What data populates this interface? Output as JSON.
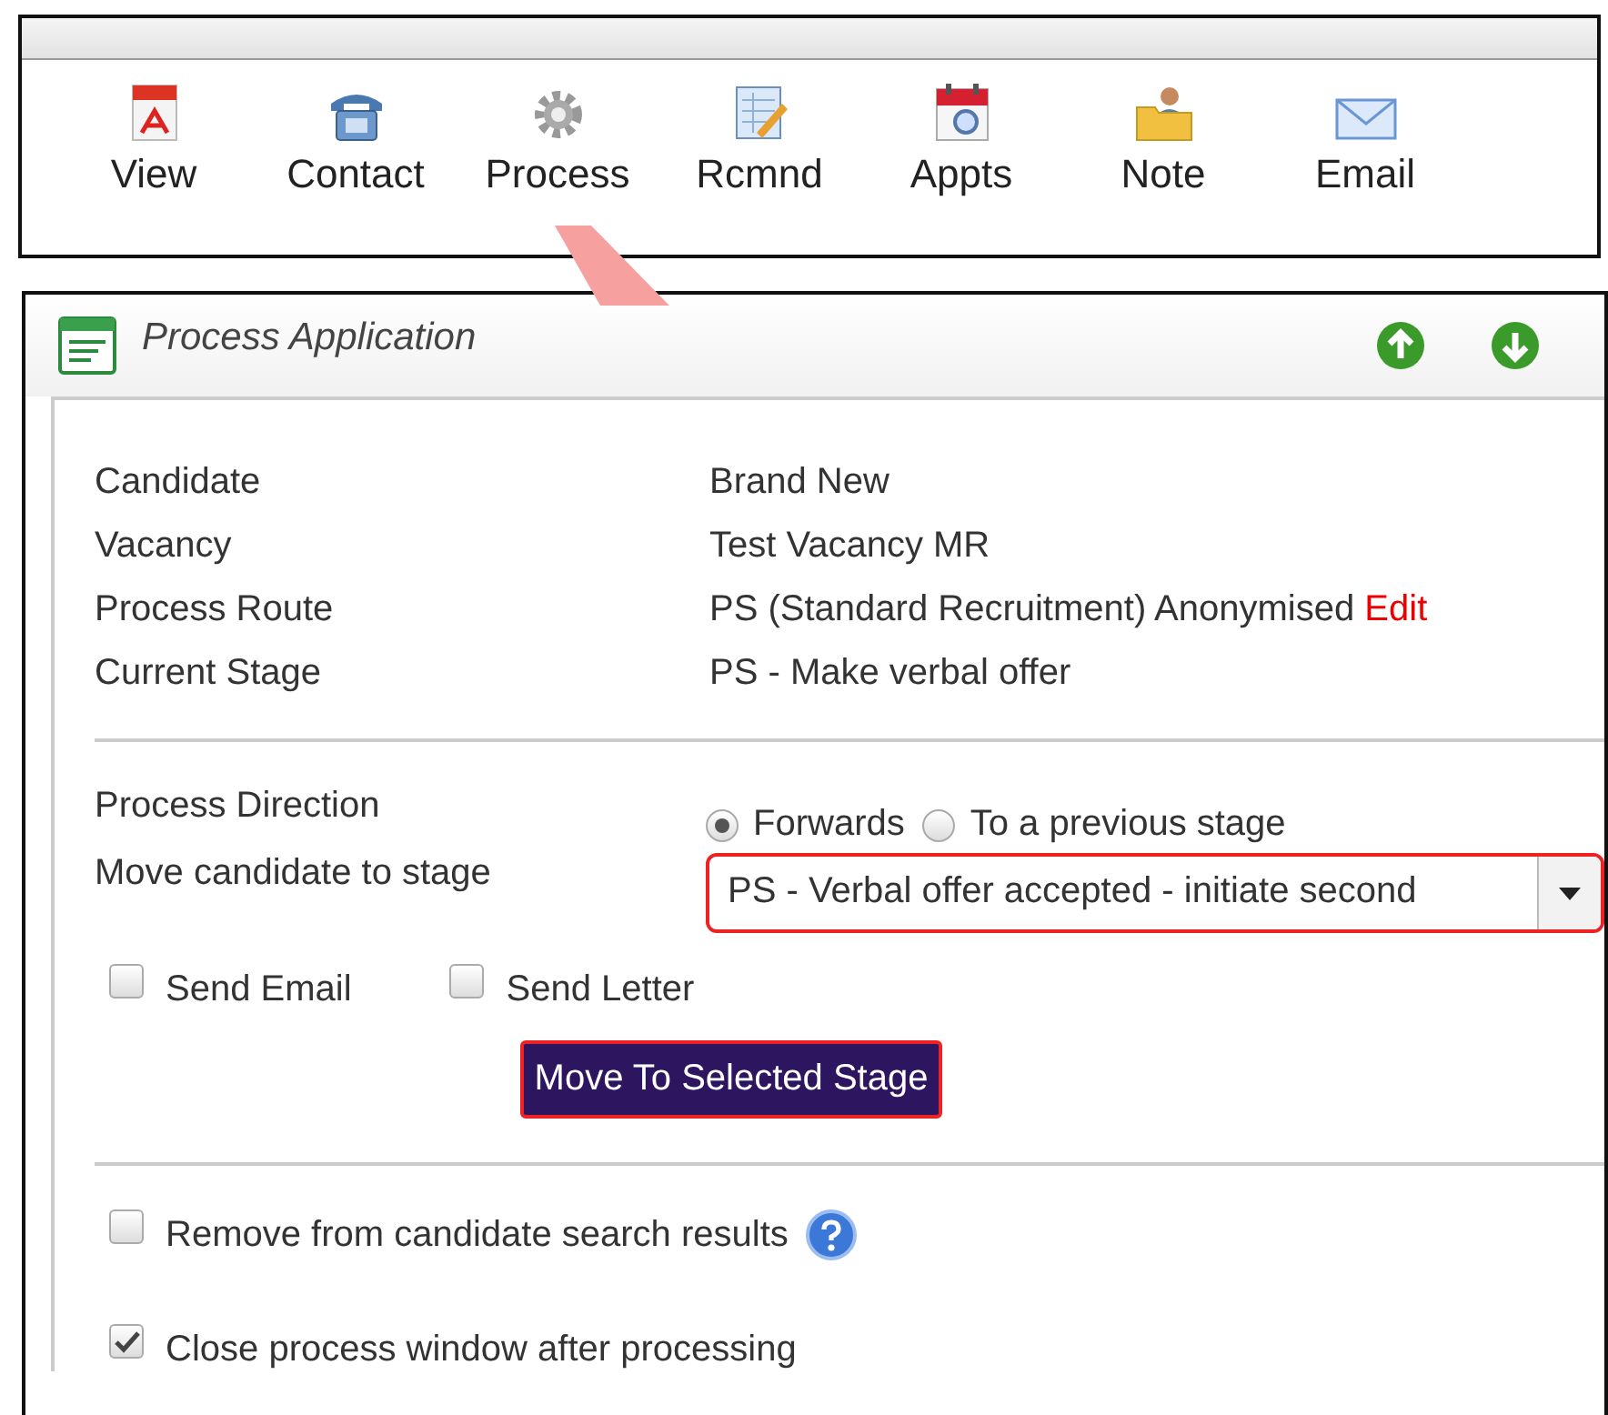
{
  "toolbar": {
    "items": [
      {
        "label": "View",
        "kind": "pdf"
      },
      {
        "label": "Contact",
        "kind": "phone"
      },
      {
        "label": "Process",
        "kind": "gear"
      },
      {
        "label": "Rcmnd",
        "kind": "notepad"
      },
      {
        "label": "Appts",
        "kind": "calendar"
      },
      {
        "label": "Note",
        "kind": "note"
      },
      {
        "label": "Email",
        "kind": "mail"
      }
    ]
  },
  "panel": {
    "title": "Process Application",
    "details": [
      {
        "label": "Candidate",
        "value": "Brand New"
      },
      {
        "label": "Vacancy",
        "value": "Test Vacancy MR"
      },
      {
        "label": "Process Route",
        "value": "PS (Standard Recruitment) Anonymised",
        "link": "Edit"
      },
      {
        "label": "Current Stage",
        "value": "PS - Make verbal offer"
      }
    ],
    "direction": {
      "label": "Process Direction",
      "options": [
        {
          "label": "Forwards",
          "selected": true
        },
        {
          "label": "To a previous stage",
          "selected": false
        }
      ]
    },
    "stage": {
      "label": "Move candidate to stage",
      "value": "PS - Verbal offer accepted - initiate second"
    },
    "send_options": [
      {
        "label": "Send Email",
        "checked": false
      },
      {
        "label": "Send Letter",
        "checked": false
      }
    ],
    "submit": "Move To Selected Stage",
    "options": [
      {
        "label": "Remove from candidate search results",
        "checked": false,
        "help": true
      },
      {
        "label": "Close process window after processing",
        "checked": true,
        "help": false
      }
    ]
  }
}
